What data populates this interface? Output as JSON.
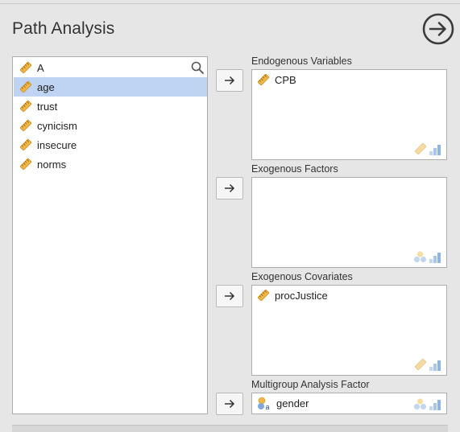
{
  "page": {
    "title": "Path Analysis"
  },
  "toolbar": {
    "run_icon": "arrow-right-circle-icon"
  },
  "source_list": {
    "search_icon": "search-icon",
    "items": [
      {
        "label": "A",
        "icon": "ruler-icon",
        "selected": false
      },
      {
        "label": "age",
        "icon": "ruler-icon",
        "selected": true
      },
      {
        "label": "trust",
        "icon": "ruler-icon",
        "selected": false
      },
      {
        "label": "cynicism",
        "icon": "ruler-icon",
        "selected": false
      },
      {
        "label": "insecure",
        "icon": "ruler-icon",
        "selected": false
      },
      {
        "label": "norms",
        "icon": "ruler-icon",
        "selected": false
      }
    ]
  },
  "sections": [
    {
      "label": "Endogenous Variables",
      "items": [
        "CPB"
      ],
      "item_icon": "ruler-icon",
      "badges": [
        "ruler-icon",
        "bar-chart-icon"
      ]
    },
    {
      "label": "Exogenous Factors",
      "items": [],
      "badges": [
        "nominal-icon",
        "bar-chart-icon"
      ]
    },
    {
      "label": "Exogenous Covariates",
      "items": [
        "procJustice"
      ],
      "item_icon": "ruler-icon",
      "badges": [
        "ruler-icon",
        "bar-chart-icon"
      ]
    },
    {
      "label": "Multigroup Analysis Factor",
      "items": [
        "gender"
      ],
      "item_icon": "nominal-icon",
      "badges": [
        "nominal-icon",
        "bar-chart-icon"
      ]
    }
  ],
  "colors": {
    "selection": "#bfd3f3",
    "ruler": "#f0b646",
    "badge_blue": "#a8c6ec"
  }
}
